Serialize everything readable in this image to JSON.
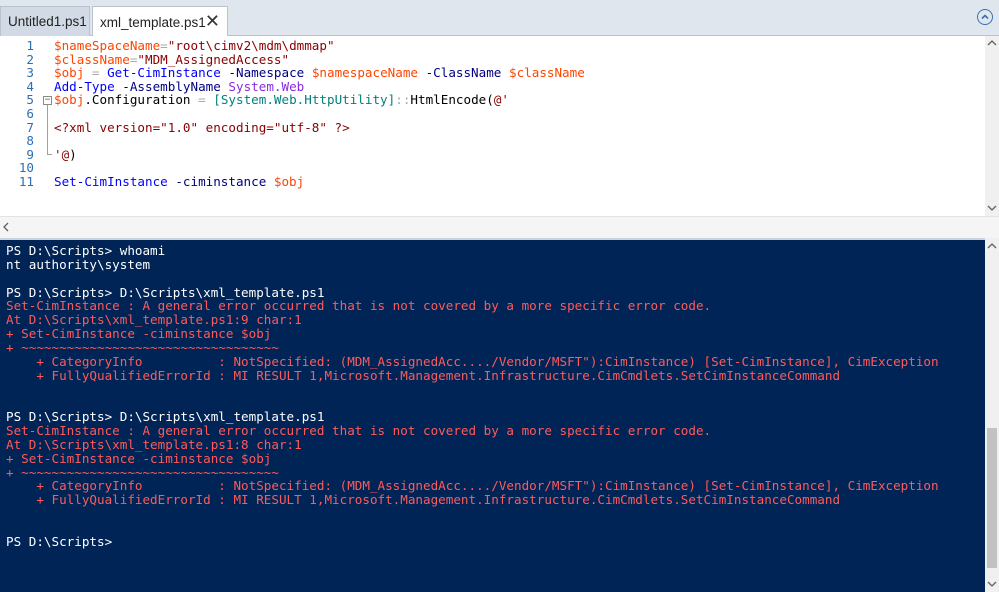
{
  "tabs": [
    {
      "label": "Untitled1.ps1",
      "active": false
    },
    {
      "label": "xml_template.ps1",
      "active": true,
      "close_glyph": "✕"
    }
  ],
  "editor": {
    "lines": [
      {
        "n": "1",
        "tokens": [
          {
            "t": "$nameSpaceName",
            "c": "var"
          },
          {
            "t": "=",
            "c": "op"
          },
          {
            "t": "\"root\\cimv2\\mdm\\dmmap\"",
            "c": "str"
          }
        ]
      },
      {
        "n": "2",
        "tokens": [
          {
            "t": "$className",
            "c": "var"
          },
          {
            "t": "=",
            "c": "op"
          },
          {
            "t": "\"MDM_AssignedAccess\"",
            "c": "str"
          }
        ]
      },
      {
        "n": "3",
        "tokens": [
          {
            "t": "$obj",
            "c": "var"
          },
          {
            "t": " = ",
            "c": "op"
          },
          {
            "t": "Get-CimInstance",
            "c": "cmd"
          },
          {
            "t": " -Namespace ",
            "c": "param"
          },
          {
            "t": "$namespaceName",
            "c": "var"
          },
          {
            "t": " -ClassName ",
            "c": "param"
          },
          {
            "t": "$className",
            "c": "var"
          }
        ]
      },
      {
        "n": "4",
        "tokens": [
          {
            "t": "Add-Type",
            "c": "cmd"
          },
          {
            "t": " -AssemblyName ",
            "c": "param"
          },
          {
            "t": "System.Web",
            "c": "arg"
          }
        ]
      },
      {
        "n": "5",
        "fold": "−",
        "tokens": [
          {
            "t": "$obj",
            "c": "var"
          },
          {
            "t": ".Configuration",
            "c": "mem"
          },
          {
            "t": " = ",
            "c": "op"
          },
          {
            "t": "[System.Web.HttpUtility]",
            "c": "type"
          },
          {
            "t": "::",
            "c": "op"
          },
          {
            "t": "HtmlEncode(",
            "c": "mem"
          },
          {
            "t": "@'",
            "c": "str"
          }
        ]
      },
      {
        "n": "6",
        "tokens": []
      },
      {
        "n": "7",
        "tokens": [
          {
            "t": "<?xml version=\"1.0\" encoding=\"utf-8\" ?>",
            "c": "str"
          }
        ]
      },
      {
        "n": "8",
        "tokens": []
      },
      {
        "n": "9",
        "tokens": [
          {
            "t": "'@",
            "c": "str"
          },
          {
            "t": ")",
            "c": "mem"
          }
        ]
      },
      {
        "n": "10",
        "tokens": []
      },
      {
        "n": "11",
        "tokens": [
          {
            "t": "Set-CimInstance",
            "c": "cmd"
          },
          {
            "t": " -ciminstance ",
            "c": "param"
          },
          {
            "t": "$obj",
            "c": "var"
          }
        ]
      }
    ]
  },
  "console": {
    "lines": [
      {
        "t": "PS D:\\Scripts> whoami",
        "err": false
      },
      {
        "t": "nt authority\\system",
        "err": false
      },
      {
        "t": "",
        "err": false
      },
      {
        "t": "PS D:\\Scripts> D:\\Scripts\\xml_template.ps1",
        "err": false
      },
      {
        "t": "Set-CimInstance : A general error occurred that is not covered by a more specific error code.",
        "err": true
      },
      {
        "t": "At D:\\Scripts\\xml_template.ps1:9 char:1",
        "err": true
      },
      {
        "t": "+ Set-CimInstance -ciminstance $obj",
        "err": true
      },
      {
        "t": "+ ~~~~~~~~~~~~~~~~~~~~~~~~~~~~~~~~~~",
        "err": true
      },
      {
        "t": "    + CategoryInfo          : NotSpecified: (MDM_AssignedAcc..../Vendor/MSFT\"):CimInstance) [Set-CimInstance], CimException",
        "err": true
      },
      {
        "t": "    + FullyQualifiedErrorId : MI RESULT 1,Microsoft.Management.Infrastructure.CimCmdlets.SetCimInstanceCommand",
        "err": true
      },
      {
        "t": "",
        "err": false
      },
      {
        "t": "",
        "err": false
      },
      {
        "t": "PS D:\\Scripts> D:\\Scripts\\xml_template.ps1",
        "err": false
      },
      {
        "t": "Set-CimInstance : A general error occurred that is not covered by a more specific error code.",
        "err": true
      },
      {
        "t": "At D:\\Scripts\\xml_template.ps1:8 char:1",
        "err": true
      },
      {
        "t": "+ Set-CimInstance -ciminstance $obj",
        "err": true
      },
      {
        "t": "+ ~~~~~~~~~~~~~~~~~~~~~~~~~~~~~~~~~~",
        "err": true
      },
      {
        "t": "    + CategoryInfo          : NotSpecified: (MDM_AssignedAcc..../Vendor/MSFT\"):CimInstance) [Set-CimInstance], CimException",
        "err": true
      },
      {
        "t": "    + FullyQualifiedErrorId : MI RESULT 1,Microsoft.Management.Infrastructure.CimCmdlets.SetCimInstanceCommand",
        "err": true
      },
      {
        "t": "",
        "err": false
      },
      {
        "t": "",
        "err": false
      },
      {
        "t": "PS D:\\Scripts>",
        "err": false
      }
    ]
  },
  "colors": {
    "console_bg": "#012456",
    "console_error": "#ff5a5a",
    "editor_bg": "#ffffff"
  },
  "icons": {
    "collapse": "chevron-up-icon"
  }
}
